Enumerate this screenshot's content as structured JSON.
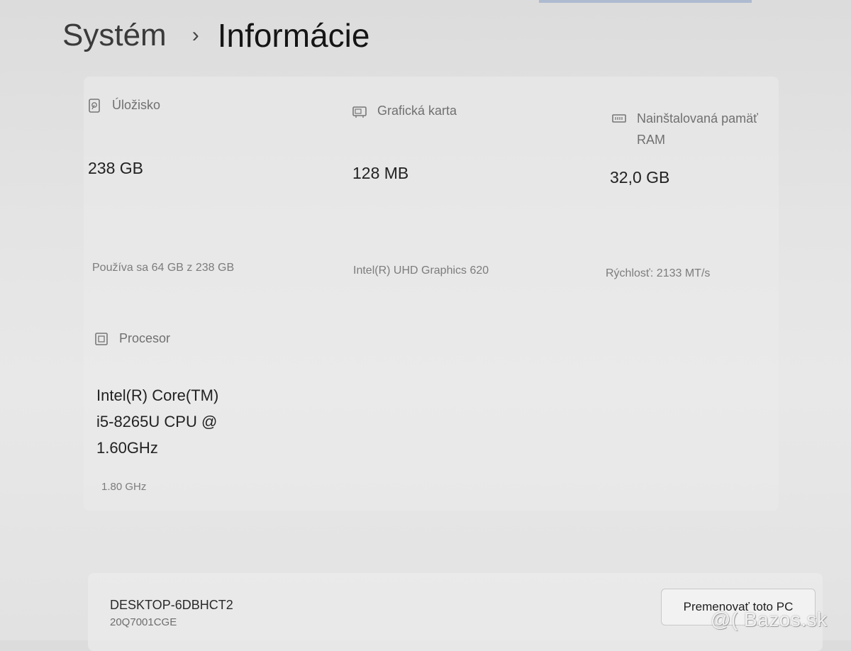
{
  "breadcrumb": {
    "parent": "Systém",
    "separator": "›",
    "current": "Informácie"
  },
  "cards": {
    "storage": {
      "icon": "storage-icon",
      "label": "Úložisko",
      "value": "238 GB",
      "detail": "Používa sa 64 GB z 238 GB"
    },
    "graphics": {
      "icon": "graphics-card-icon",
      "label": "Grafická karta",
      "value": "128 MB",
      "detail": "Intel(R) UHD Graphics 620"
    },
    "memory": {
      "icon": "memory-icon",
      "label_line1": "Nainštalovaná pamäť",
      "label_line2": "RAM",
      "value": "32,0 GB",
      "detail": "Rýchlosť: 2133 MT/s"
    },
    "processor": {
      "icon": "processor-icon",
      "label": "Procesor",
      "value_line1": "Intel(R) Core(TM)",
      "value_line2": "i5-8265U CPU @",
      "value_line3": "1.60GHz",
      "detail": "1.80 GHz"
    }
  },
  "device": {
    "name": "DESKTOP-6DBHCT2",
    "model": "20Q7001CGE",
    "rename_button": "Premenovať toto PC"
  },
  "watermark": "@( Bazos.sk"
}
